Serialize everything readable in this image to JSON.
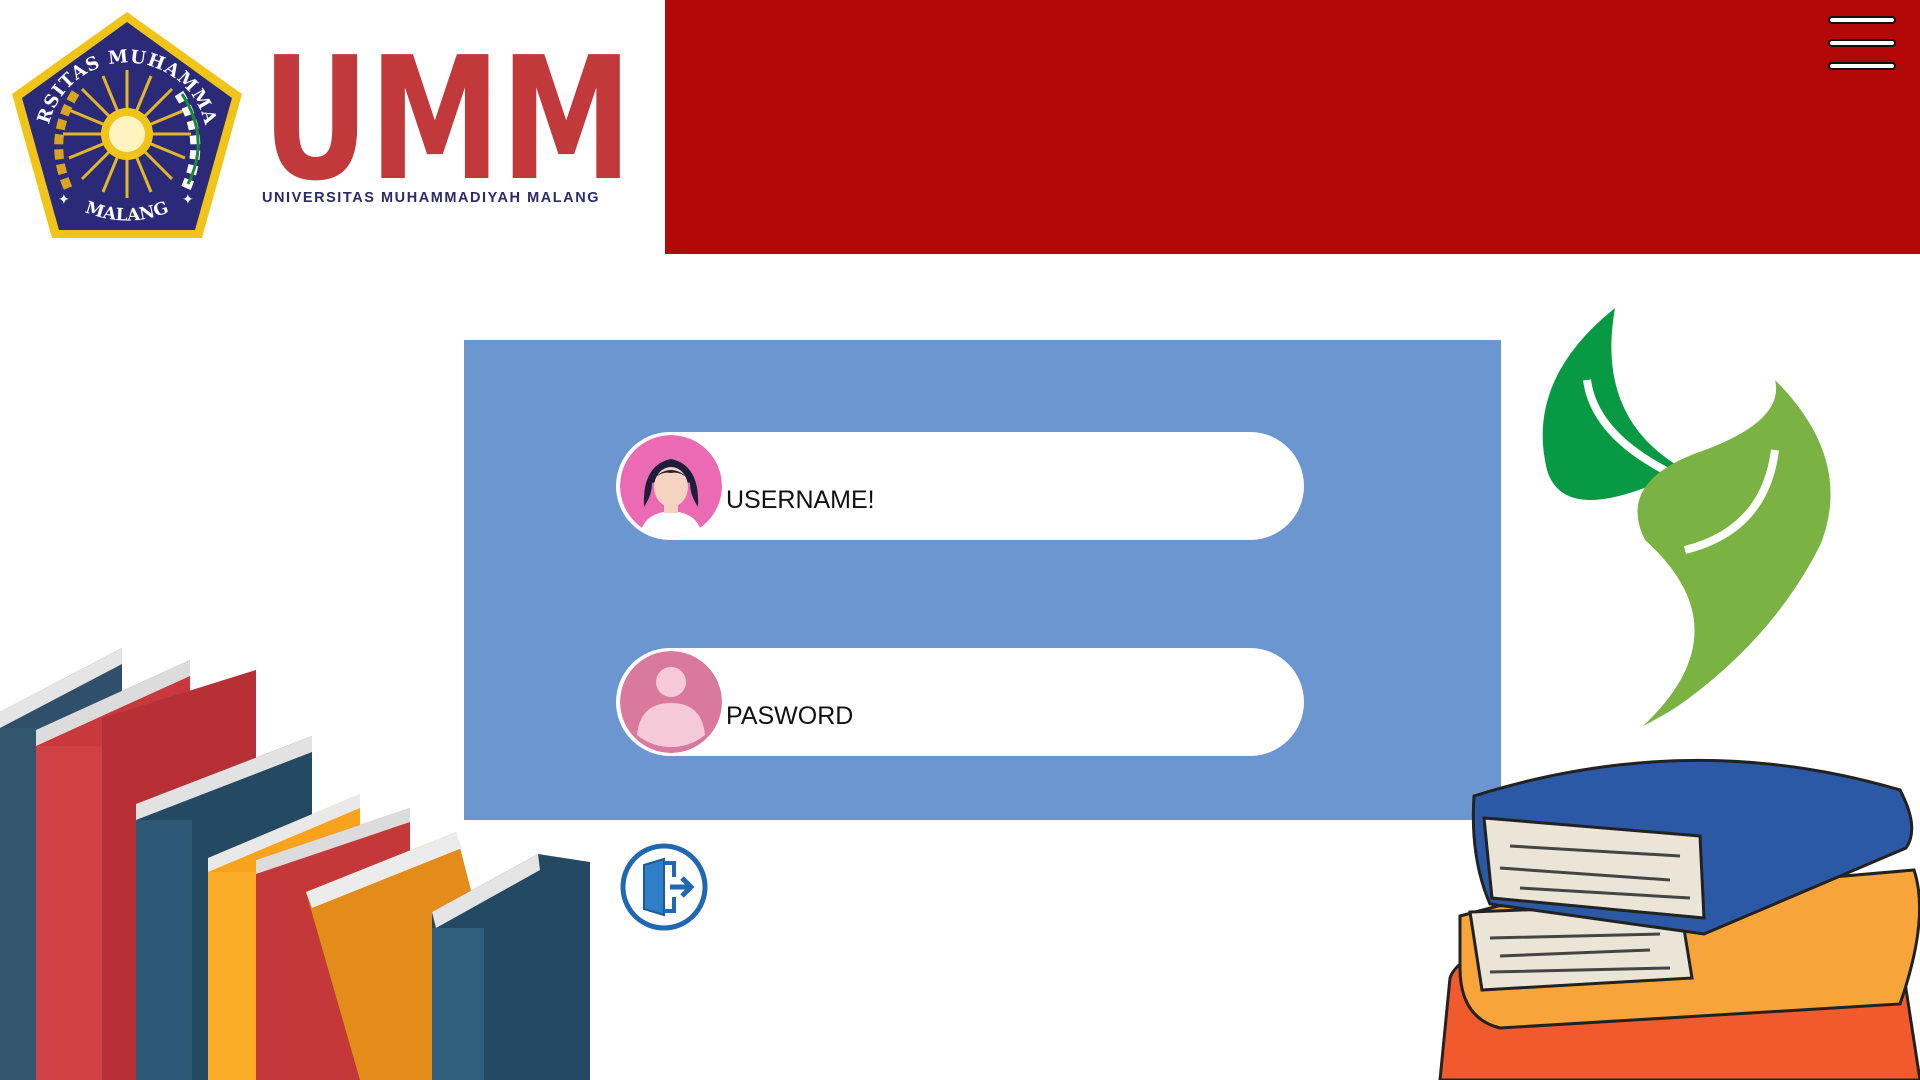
{
  "header": {
    "logo_wordmark": "UMM",
    "logo_tagline": "UNIVERSITAS MUHAMMADIYAH MALANG",
    "seal_text_top": "UNIVERSITAS MUHAMMADIYAH",
    "seal_text_bottom": "MALANG",
    "banner_color": "#b30808",
    "menu_icon": "hamburger-menu-icon"
  },
  "login": {
    "panel_color": "#6b96d0",
    "username_label": "USERNAME!",
    "password_label": "PASWORD",
    "username_icon": "user-avatar-icon",
    "password_icon": "person-silhouette-icon",
    "exit_icon": "exit-door-icon"
  },
  "decor": {
    "left_illustration": "books-stack-illustration",
    "right_illustration": "books-with-leaves-illustration"
  }
}
